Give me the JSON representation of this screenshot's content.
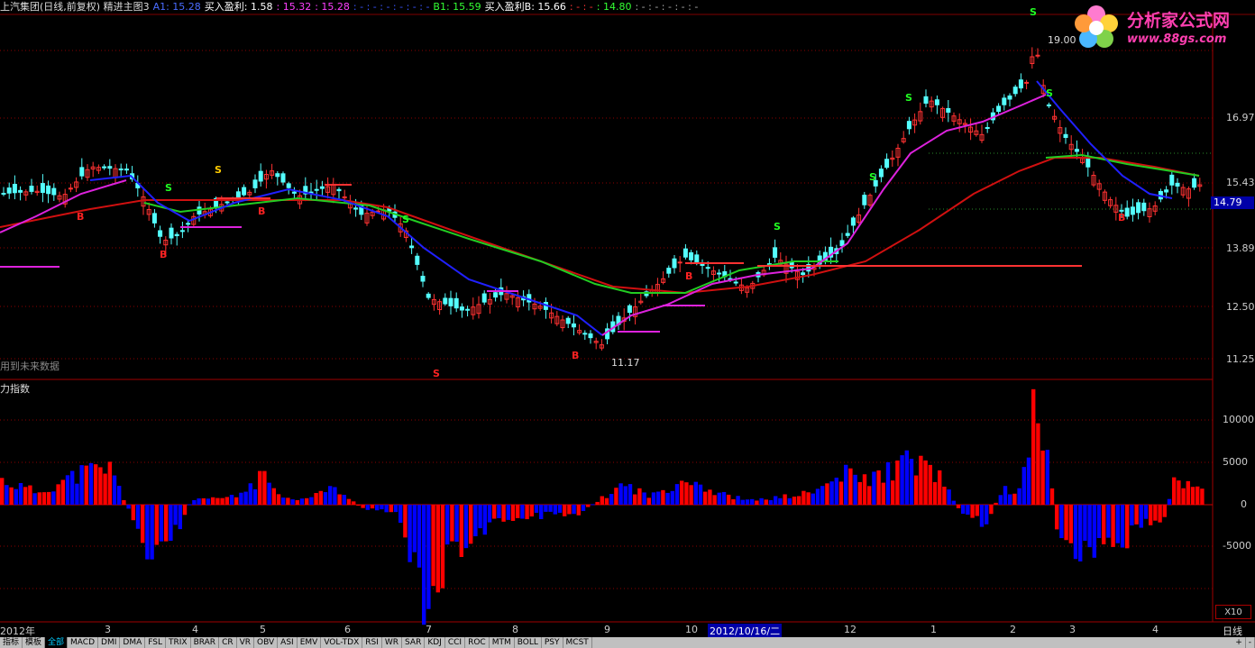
{
  "header": {
    "title": "上汽集团(日线,前复权) 精进主图3",
    "a1": "A1: 15.28",
    "buy_profit_label": "买入盈利: 1.58",
    "v1": ": 15.32",
    "v2": ": 15.28",
    "dots1": ": - : - : - : - : - : -",
    "b1": "B1: 15.59",
    "buy_profit_b": "买入盈利B: 15.66",
    "dots2": ": - : -",
    "v3": ": 14.80",
    "dots3": ": - : - : - : - : -"
  },
  "logo": {
    "name": "分析家公式网",
    "url": "www.88gs.com"
  },
  "price_axis": {
    "labels": [
      "16.97",
      "15.43",
      "13.89",
      "12.50",
      "11.25"
    ],
    "current": "14.79"
  },
  "annotations": {
    "high": "19.00",
    "low": "11.17",
    "future_note": "用到未来数据"
  },
  "indicator": {
    "title": "力指数",
    "labels": [
      "10000",
      "5000",
      "0",
      "-5000"
    ],
    "zoom": "X10"
  },
  "x_axis": {
    "labels": [
      "2012年",
      "3",
      "4",
      "5",
      "6",
      "7",
      "8",
      "9",
      "10",
      "2012/10/16/二",
      "12",
      "1",
      "2",
      "3",
      "4"
    ],
    "period": "日线"
  },
  "tabs": [
    "指标",
    "模板",
    "全部",
    "MACD",
    "DMI",
    "DMA",
    "FSL",
    "TRIX",
    "BRAR",
    "CR",
    "VR",
    "OBV",
    "ASI",
    "EMV",
    "VOL-TDX",
    "RSI",
    "WR",
    "SAR",
    "KDJ",
    "CCI",
    "ROC",
    "MTM",
    "BOLL",
    "PSY",
    "MCST"
  ],
  "tab_controls": [
    "+",
    "-"
  ],
  "signals": {
    "sell": "S",
    "buy": "B"
  },
  "colors": {
    "up": "#ff3232",
    "down": "#54ffff",
    "ma_blue": "#2020ff",
    "ma_green": "#22cc22",
    "ma_red": "#d01010",
    "ma_magenta": "#dd22dd",
    "bar_red": "#ff0000",
    "bar_blue": "#0000ff"
  }
}
